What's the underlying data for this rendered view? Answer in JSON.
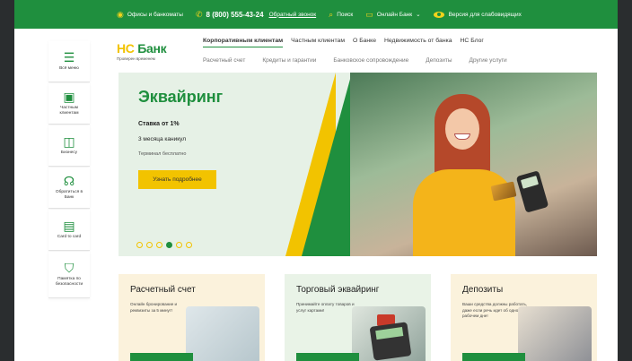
{
  "topbar": {
    "offices": "Офисы и банкоматы",
    "phone": "8 (800) 555-43-24",
    "callback": "Обратный звонок",
    "search": "Поиск",
    "online_bank": "Онлайн Банк",
    "accessibility": "Версия для слабовидящих"
  },
  "sidebar": {
    "items": [
      {
        "label": "Всё меню",
        "icon": "menu-icon"
      },
      {
        "label": "Частным клиентам",
        "icon": "wallet-icon"
      },
      {
        "label": "Бизнесу",
        "icon": "briefcase-icon"
      },
      {
        "label": "Обратиться в Банк",
        "icon": "headset-icon"
      },
      {
        "label": "Card to card",
        "icon": "card-transfer-icon"
      },
      {
        "label": "Памятка по безопасности",
        "icon": "shield-icon"
      }
    ]
  },
  "logo": {
    "hc": "НС",
    "bank": "Банк",
    "slogan": "Проверен временем"
  },
  "nav_main": [
    "Корпоративным клиентам",
    "Частным клиентам",
    "О Банке",
    "Недвижимость от банка",
    "НС Блог"
  ],
  "nav_sub": [
    "Расчетный счет",
    "Кредиты и гарантии",
    "Банковское сопровождение",
    "Депозиты",
    "Другие услуги"
  ],
  "hero": {
    "title": "Эквайринг",
    "rate": "Ставка от 1%",
    "holidays": "3 месяца каникул",
    "terminal": "Терминал бесплатно",
    "button": "Узнать подробнее",
    "slides_total": 6,
    "slide_active": 4
  },
  "cards": [
    {
      "title": "Расчетный счет",
      "text": "Онлайн бронирование и реквизиты за 5 минут!"
    },
    {
      "title": "Торговый эквайринг",
      "text": "Принимайте оплату товаров и услуг картами!"
    },
    {
      "title": "Депозиты",
      "text": "Ваши средства должны работать, даже если речь идет об одном рабочем дне!"
    }
  ],
  "colors": {
    "green": "#1f8f3e",
    "yellow": "#f2c300"
  }
}
